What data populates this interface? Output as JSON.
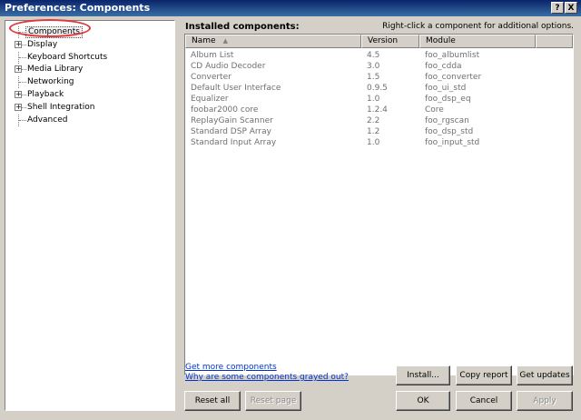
{
  "window": {
    "title": "Preferences: Components",
    "help_label": "?",
    "close_label": "X"
  },
  "tree": {
    "items": [
      {
        "label": "Components",
        "expandable": false,
        "selected": true
      },
      {
        "label": "Display",
        "expandable": true
      },
      {
        "label": "Keyboard Shortcuts",
        "expandable": false
      },
      {
        "label": "Media Library",
        "expandable": true
      },
      {
        "label": "Networking",
        "expandable": false
      },
      {
        "label": "Playback",
        "expandable": true
      },
      {
        "label": "Shell Integration",
        "expandable": true
      },
      {
        "label": "Advanced",
        "expandable": false
      }
    ],
    "expand_glyph": "+"
  },
  "panel": {
    "heading": "Installed components:",
    "hint": "Right-click a component for additional options."
  },
  "table": {
    "columns": [
      "Name",
      "Version",
      "Module"
    ],
    "sort_arrow": "▲",
    "rows": [
      [
        "Album List",
        "4.5",
        "foo_albumlist"
      ],
      [
        "CD Audio Decoder",
        "3.0",
        "foo_cdda"
      ],
      [
        "Converter",
        "1.5",
        "foo_converter"
      ],
      [
        "Default User Interface",
        "0.9.5",
        "foo_ui_std"
      ],
      [
        "Equalizer",
        "1.0",
        "foo_dsp_eq"
      ],
      [
        "foobar2000 core",
        "1.2.4",
        "Core"
      ],
      [
        "ReplayGain Scanner",
        "2.2",
        "foo_rgscan"
      ],
      [
        "Standard DSP Array",
        "1.2",
        "foo_dsp_std"
      ],
      [
        "Standard Input Array",
        "1.0",
        "foo_input_std"
      ]
    ]
  },
  "links": {
    "get_more": "Get more components",
    "grayed_out": "Why are some components grayed out?"
  },
  "buttons": {
    "install": "Install...",
    "copy_report": "Copy report",
    "get_updates": "Get updates",
    "reset_all": "Reset all",
    "reset_page": "Reset page",
    "ok": "OK",
    "cancel": "Cancel",
    "apply": "Apply"
  },
  "colors": {
    "highlight_ring": "#e2383b",
    "titlebar": "#0a246a"
  }
}
